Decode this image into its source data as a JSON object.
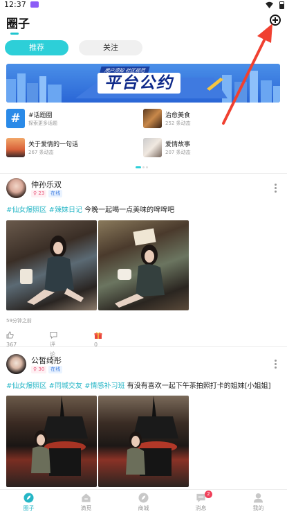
{
  "status_bar": {
    "time": "12:37"
  },
  "header": {
    "title": "圈子"
  },
  "tabs": [
    {
      "label": "推荐",
      "active": true
    },
    {
      "label": "关注",
      "active": false
    }
  ],
  "banner": {
    "subtitle": "用户须知 社区规范",
    "title": "平台公约"
  },
  "topics": [
    {
      "name": "#话题圈",
      "count": "探索更多话题"
    },
    {
      "name": "治愈美食",
      "count": "252 条动态"
    },
    {
      "name": "关于爱情的一句话",
      "count": "267 条动态"
    },
    {
      "name": "爱情故事",
      "count": "207 条动态"
    }
  ],
  "posts": [
    {
      "username": "仲孙乐双",
      "fans": "23",
      "online": "在线",
      "tags": [
        "#仙女爆照区",
        "#辣妹日记"
      ],
      "text": "今晚一起喝一点美味的啤啤吧",
      "time": "59分钟之前",
      "likes": "367",
      "comment_label": "评论",
      "gifts": "0"
    },
    {
      "username": "公皙绮彤",
      "fans": "30",
      "online": "在线",
      "tags": [
        "#仙女爆照区",
        "#同城交友",
        "#情感补习班"
      ],
      "text": "有没有喜欢一起下午茶拍照打卡的姐妹[小姐姐]"
    }
  ],
  "bottom_nav": [
    {
      "label": "圈子",
      "icon": "compass-leaf-icon",
      "active": true
    },
    {
      "label": "滴觅",
      "icon": "home-icon",
      "active": false
    },
    {
      "label": "商城",
      "icon": "compass-icon",
      "active": false
    },
    {
      "label": "消息",
      "icon": "message-icon",
      "active": false,
      "badge": "2"
    },
    {
      "label": "我的",
      "icon": "user-icon",
      "active": false
    }
  ],
  "colors": {
    "accent": "#2dcfd8",
    "hashtag": "#26b6c6",
    "annotation_arrow": "#f04030"
  }
}
